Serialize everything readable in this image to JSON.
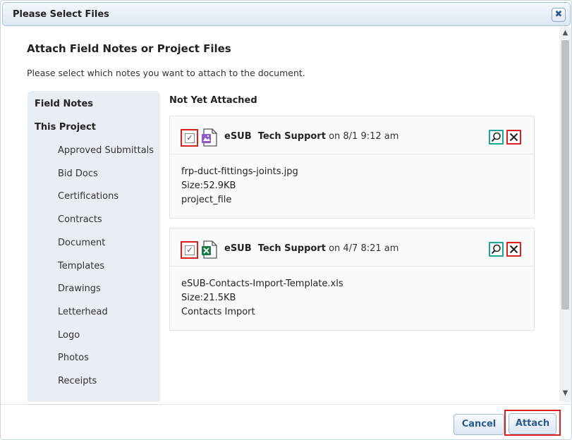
{
  "dialog": {
    "title": "Please Select Files"
  },
  "main": {
    "heading": "Attach Field Notes or Project Files",
    "subheading": "Please select which notes you want to attach to the document."
  },
  "sidebar": {
    "field_notes": "Field Notes",
    "this_project": "This Project",
    "items": [
      "Approved Submittals",
      "Bid Docs",
      "Certifications",
      "Contracts",
      "Document",
      "Templates",
      "Drawings",
      "Letterhead",
      "Logo",
      "Photos",
      "Receipts"
    ]
  },
  "files": {
    "section_title": "Not Yet Attached",
    "cards": [
      {
        "checked": true,
        "icon": "image-file-icon",
        "author": "eSUB  Tech Support",
        "date": " on 8/1 9:12 am",
        "filename": "frp-duct-fittings-joints.jpg",
        "size": "Size:52.9KB",
        "category": "project_file"
      },
      {
        "checked": true,
        "icon": "excel-file-icon",
        "author": "eSUB  Tech Support",
        "date": " on 4/7 8:21 am",
        "filename": "eSUB-Contacts-Import-Template.xls",
        "size": "Size:21.5KB",
        "category": "Contacts Import"
      }
    ]
  },
  "footer": {
    "cancel_label": "Cancel",
    "attach_label": "Attach"
  },
  "colors": {
    "accent": "#2a5a8c",
    "highlight": "#d9201f",
    "view_icon": "#19a79a",
    "sidebar_bg": "#e8eef4"
  }
}
